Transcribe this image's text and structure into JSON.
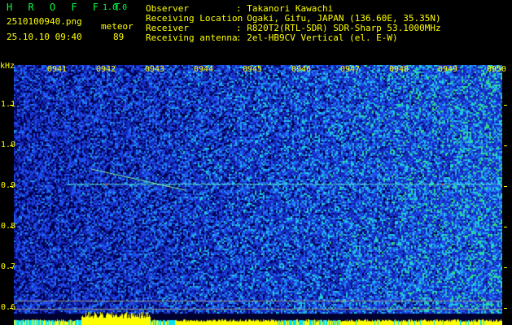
{
  "app": {
    "name": "H R O F F T",
    "version": "1.0.0"
  },
  "file": {
    "filename": "2510100940.png",
    "datetime": "25.10.10 09:40"
  },
  "meteor": {
    "label": "meteor",
    "count": "89"
  },
  "info": [
    {
      "label": "Observer",
      "value": ": Takanori Kawachi"
    },
    {
      "label": "Receiving Location",
      "value": ": Ogaki, Gifu, JAPAN (136.60E, 35.35N)"
    },
    {
      "label": "Receiver",
      "value": ": R820T2(RTL-SDR) SDR-Sharp 53.1000MHz"
    },
    {
      "label": "Receiving antenna",
      "value": ": 2el-HB9CV Vertical (el. E-W)"
    }
  ],
  "axis": {
    "y_unit": "kHz",
    "y_ticks": [
      "1.1",
      "1.0",
      "0.9",
      "0.8",
      "0.7",
      "0.6"
    ],
    "x_ticks": [
      "0941",
      "0942",
      "0943",
      "0944",
      "0945",
      "0946",
      "0947",
      "0948",
      "0949",
      "0950"
    ]
  },
  "colors": {
    "text": "#ffff00",
    "logo": "#00ff40",
    "noise": "#1030d0",
    "echo": "#00ffff"
  }
}
